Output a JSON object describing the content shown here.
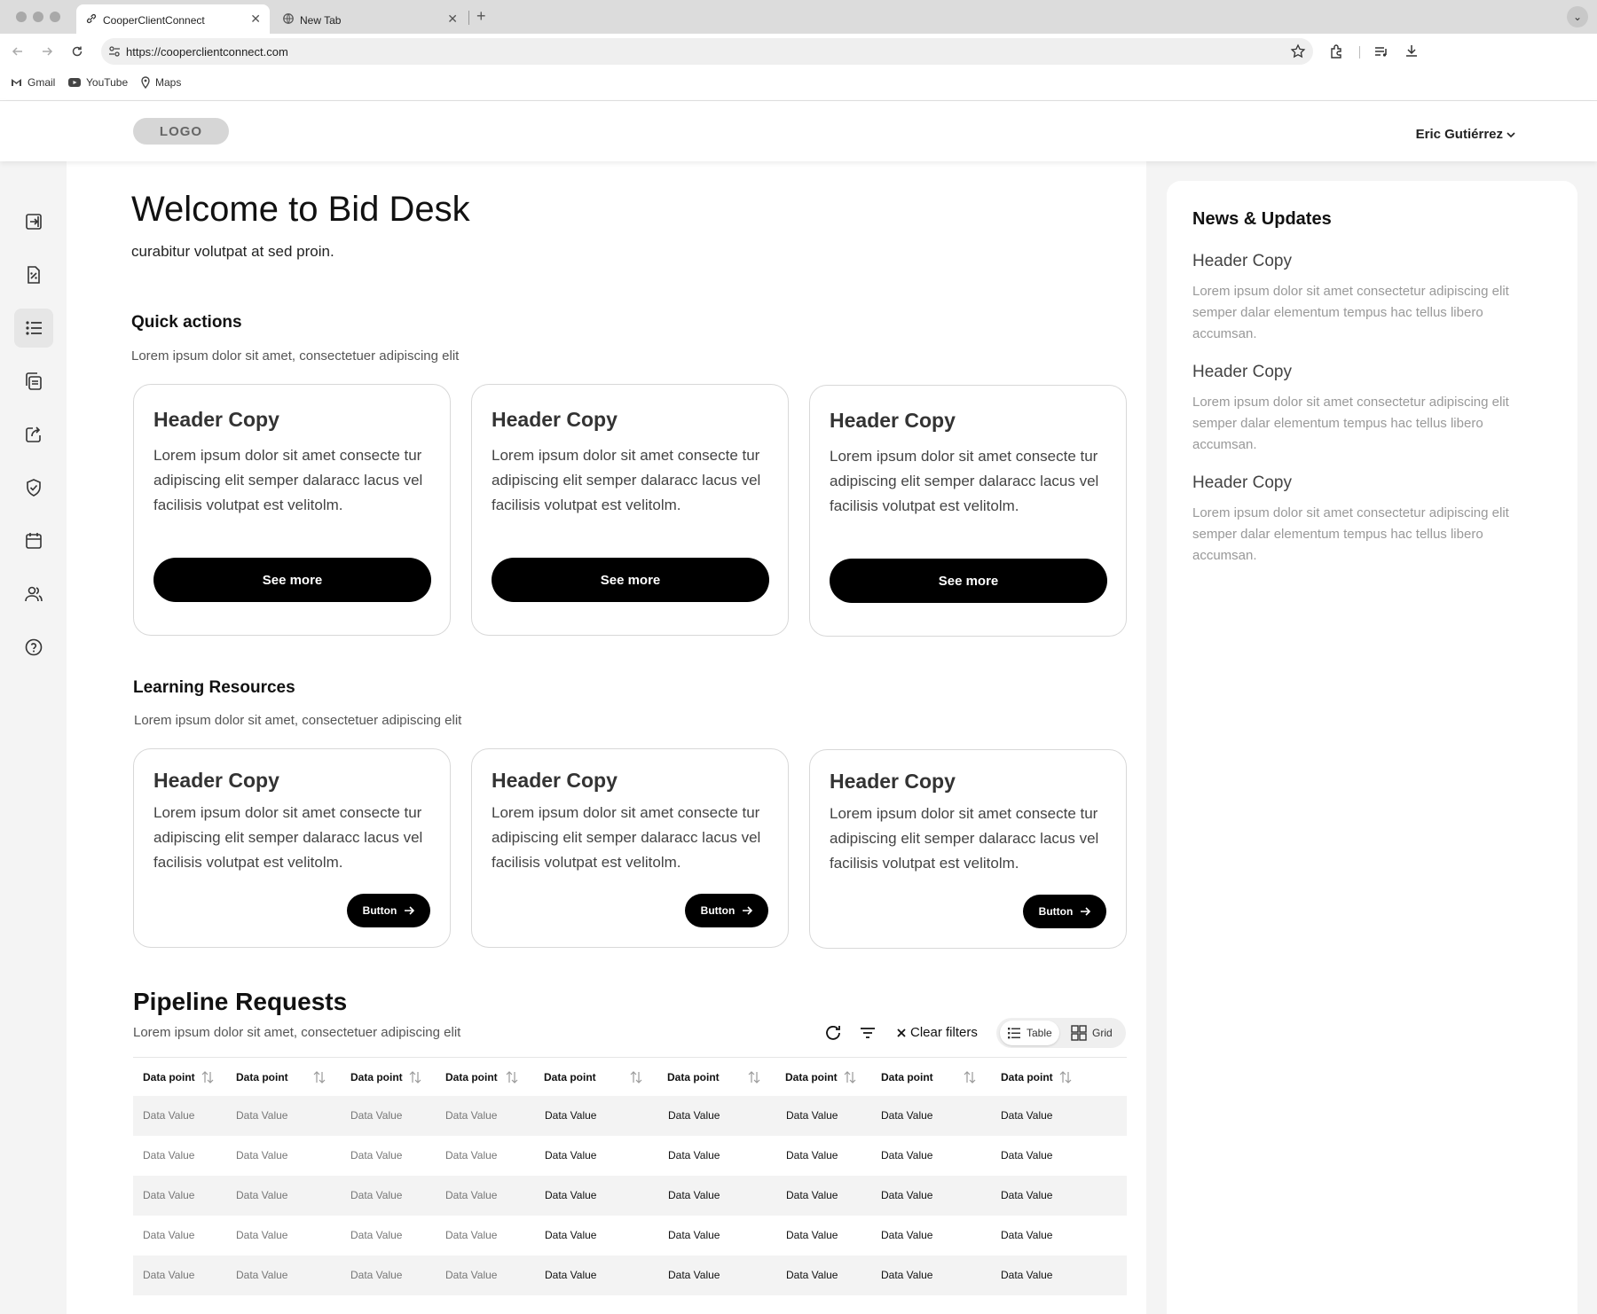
{
  "browser": {
    "tabs": [
      {
        "title": "CooperClientConnect",
        "active": true
      },
      {
        "title": "New Tab",
        "active": false
      }
    ],
    "new_tab": "+",
    "url": "https://cooperclientconnect.com",
    "bookmarks": [
      "Gmail",
      "YouTube",
      "Maps"
    ]
  },
  "header": {
    "logo": "LOGO",
    "user_name": "Eric Gutiérrez"
  },
  "rail": {
    "icons": [
      "sign-in-icon",
      "percent-document-icon",
      "list-icon",
      "copy-document-icon",
      "share-icon",
      "shield-check-icon",
      "calendar-icon",
      "users-icon",
      "help-icon"
    ],
    "active_index": 2
  },
  "main": {
    "title": "Welcome to Bid Desk",
    "subtitle": "curabitur volutpat at sed proin.",
    "quick_actions": {
      "title": "Quick actions",
      "description": "Lorem ipsum dolor sit amet, consectetuer adipiscing elit",
      "cards": [
        {
          "title": "Header Copy",
          "body": "Lorem ipsum dolor sit amet consecte tur adipiscing elit semper dalaracc lacus vel facilisis volutpat est velitolm.",
          "button": "See more"
        },
        {
          "title": "Header Copy",
          "body": "Lorem ipsum dolor sit amet consecte tur adipiscing elit semper dalaracc lacus vel facilisis volutpat est velitolm.",
          "button": "See more"
        },
        {
          "title": "Header Copy",
          "body": "Lorem ipsum dolor sit amet consecte tur adipiscing elit semper dalaracc lacus vel facilisis volutpat est velitolm.",
          "button": "See more"
        }
      ]
    },
    "learning": {
      "title": "Learning Resources",
      "description": "Lorem ipsum dolor sit amet, consectetuer adipiscing elit",
      "cards": [
        {
          "title": "Header Copy",
          "body": "Lorem ipsum dolor sit amet consecte tur adipiscing elit semper dalaracc lacus vel facilisis volutpat est velitolm.",
          "button": "Button"
        },
        {
          "title": "Header Copy",
          "body": "Lorem ipsum dolor sit amet consecte tur adipiscing elit semper dalaracc lacus vel facilisis volutpat est velitolm.",
          "button": "Button"
        },
        {
          "title": "Header Copy",
          "body": "Lorem ipsum dolor sit amet consecte tur adipiscing elit semper dalaracc lacus vel facilisis volutpat est velitolm.",
          "button": "Button"
        }
      ]
    },
    "pipeline": {
      "title": "Pipeline Requests",
      "description": "Lorem ipsum dolor sit amet, consectetuer adipiscing elit",
      "clear_filters": "Clear filters",
      "view_table": "Table",
      "view_grid": "Grid",
      "columns": [
        "Data point",
        "Data point",
        "Data point",
        "Data point",
        "Data point",
        "Data point",
        "Data point",
        "Data point",
        "Data point"
      ],
      "rows": [
        [
          "Data Value",
          "Data Value",
          "Data Value",
          "Data Value",
          "Data Value",
          "Data Value",
          "Data Value",
          "Data Value",
          "Data Value"
        ],
        [
          "Data Value",
          "Data Value",
          "Data Value",
          "Data Value",
          "Data Value",
          "Data Value",
          "Data Value",
          "Data Value",
          "Data Value"
        ],
        [
          "Data Value",
          "Data Value",
          "Data Value",
          "Data Value",
          "Data Value",
          "Data Value",
          "Data Value",
          "Data Value",
          "Data Value"
        ],
        [
          "Data Value",
          "Data Value",
          "Data Value",
          "Data Value",
          "Data Value",
          "Data Value",
          "Data Value",
          "Data Value",
          "Data Value"
        ],
        [
          "Data Value",
          "Data Value",
          "Data Value",
          "Data Value",
          "Data Value",
          "Data Value",
          "Data Value",
          "Data Value",
          "Data Value"
        ]
      ]
    }
  },
  "news": {
    "title": "News & Updates",
    "items": [
      {
        "title": "Header Copy",
        "body": "Lorem ipsum dolor sit amet consectetur adipiscing elit semper dalar elementum tempus hac tellus libero accumsan."
      },
      {
        "title": "Header Copy",
        "body": "Lorem ipsum dolor sit amet consectetur adipiscing elit semper dalar elementum tempus hac tellus libero accumsan."
      },
      {
        "title": "Header Copy",
        "body": "Lorem ipsum dolor sit amet consectetur adipiscing elit semper dalar elementum tempus hac tellus libero accumsan."
      }
    ]
  }
}
